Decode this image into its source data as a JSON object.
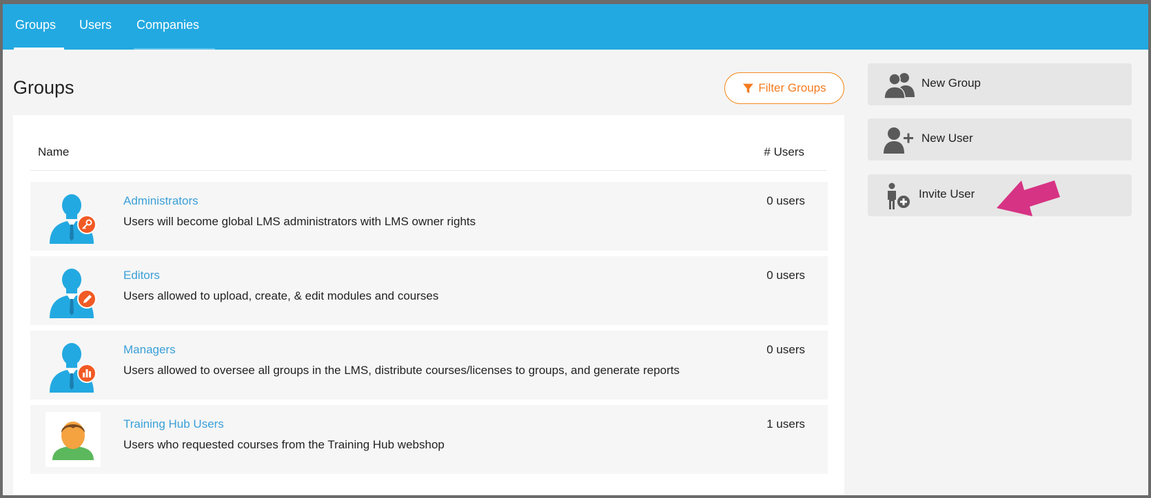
{
  "nav": {
    "tabs": [
      {
        "label": "Groups",
        "active": true
      },
      {
        "label": "Users",
        "active": false
      },
      {
        "label": "Companies",
        "active": false
      }
    ]
  },
  "page": {
    "title": "Groups",
    "filter_label": "Filter Groups"
  },
  "table": {
    "col_name": "Name",
    "col_users": "# Users",
    "rows": [
      {
        "name": "Administrators",
        "description": "Users will become global LMS administrators with LMS owner rights",
        "users": "0 users",
        "icon": "admin-key-icon"
      },
      {
        "name": "Editors",
        "description": "Users allowed to upload, create, & edit modules and courses",
        "users": "0 users",
        "icon": "editor-pencil-icon"
      },
      {
        "name": "Managers",
        "description": "Users allowed to oversee all groups in the LMS, distribute courses/licenses to groups, and generate reports",
        "users": "0 users",
        "icon": "manager-chart-icon"
      },
      {
        "name": "Training Hub Users",
        "description": "Users who requested courses from the Training Hub webshop",
        "users": "1 users",
        "icon": "person-avatar-icon"
      }
    ]
  },
  "actions": {
    "new_group": "New Group",
    "new_user": "New User",
    "invite_user": "Invite User"
  },
  "colors": {
    "nav_bg": "#23a9e1",
    "link": "#3a9fd8",
    "filter": "#f47b20",
    "badge": "#f15a24",
    "annotation_arrow": "#d63384"
  }
}
